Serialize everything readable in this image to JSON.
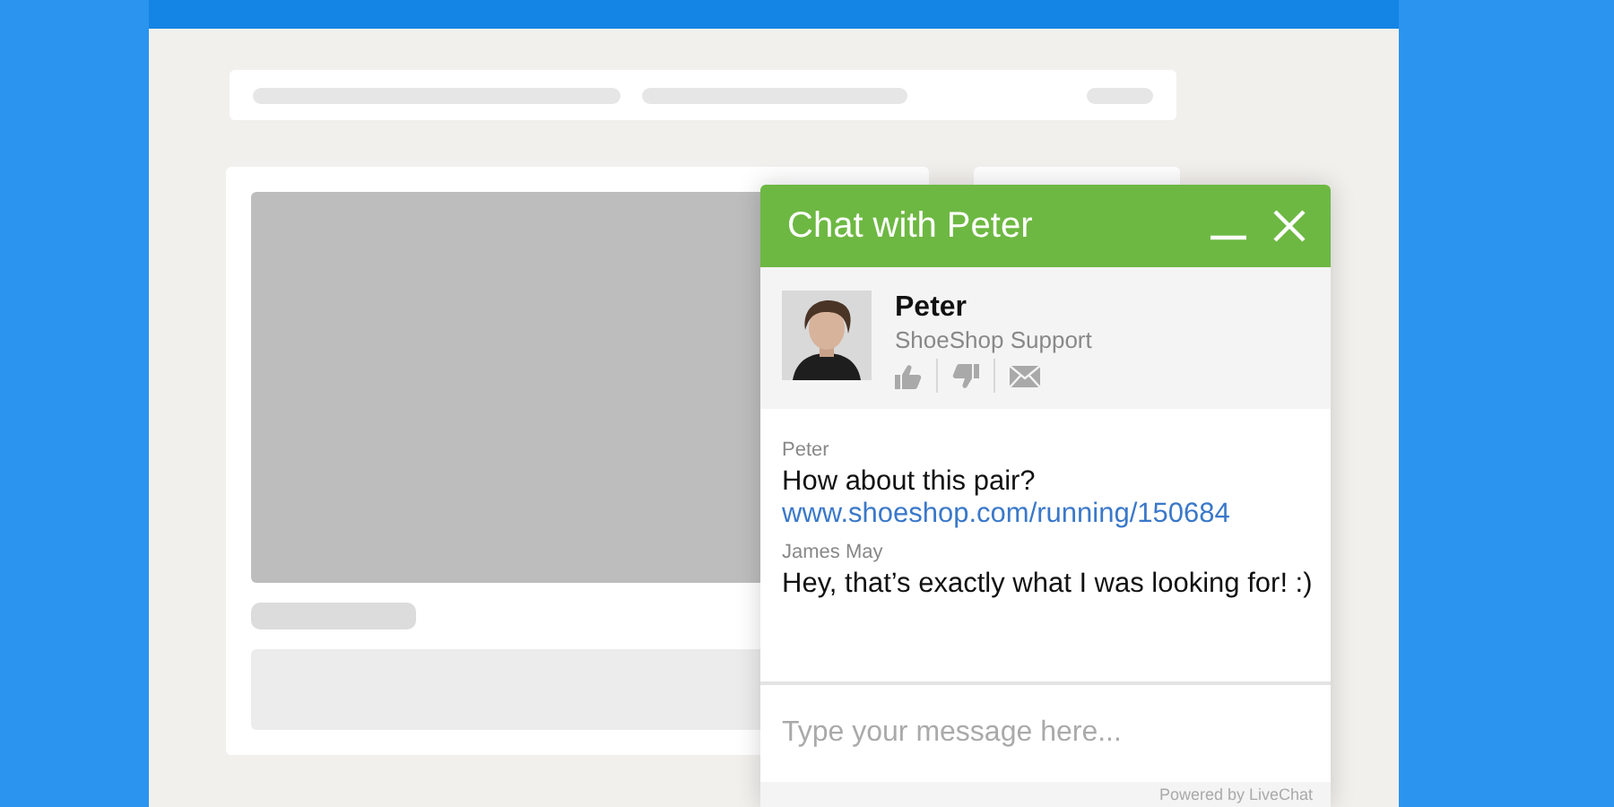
{
  "chat": {
    "title": "Chat with Peter",
    "agent": {
      "name": "Peter",
      "role": "ShoeShop Support"
    },
    "messages": [
      {
        "author": "Peter",
        "lines": [
          {
            "kind": "text",
            "text": "How about this pair?"
          },
          {
            "kind": "link",
            "text": "www.shoeshop.com/running/150684"
          }
        ]
      },
      {
        "author": "James May",
        "lines": [
          {
            "kind": "text",
            "text": "Hey, that’s exactly what I was looking for! :)"
          }
        ]
      }
    ],
    "input": {
      "placeholder": "Type your message here..."
    },
    "footer": "Powered by LiveChat"
  }
}
